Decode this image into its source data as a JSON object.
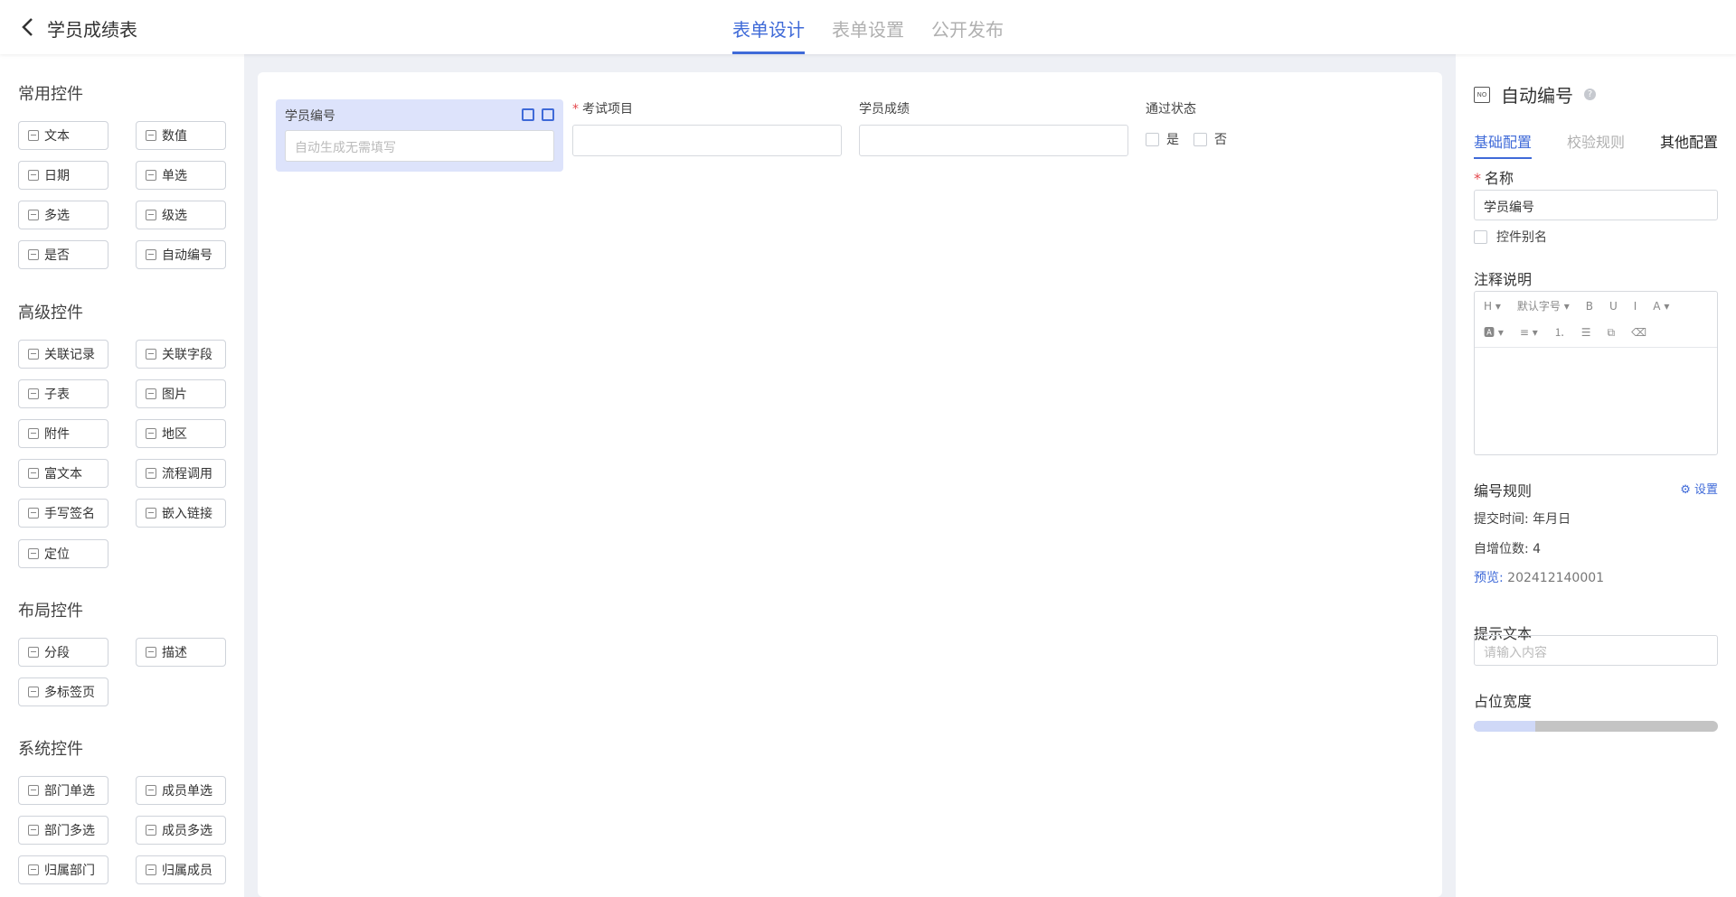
{
  "header": {
    "title": "学员成绩表",
    "tabs": [
      "表单设计",
      "表单设置",
      "公开发布"
    ]
  },
  "palette": {
    "common_title": "常用控件",
    "common": [
      "文本",
      "数值",
      "日期",
      "单选",
      "多选",
      "级选",
      "是否",
      "自动编号"
    ],
    "advanced_title": "高级控件",
    "advanced": [
      "关联记录",
      "关联字段",
      "子表",
      "图片",
      "附件",
      "地区",
      "富文本",
      "流程调用",
      "手写签名",
      "嵌入链接",
      "定位"
    ],
    "layout_title": "布局控件",
    "layout": [
      "分段",
      "描述",
      "多标签页"
    ],
    "system_title": "系统控件",
    "system": [
      "部门单选",
      "成员单选",
      "部门多选",
      "成员多选",
      "归属部门",
      "归属成员"
    ]
  },
  "canvas": {
    "fields": [
      {
        "label": "学员编号",
        "placeholder": "自动生成无需填写"
      },
      {
        "label": "考试项目",
        "required_mark": "*"
      },
      {
        "label": "学员成绩"
      },
      {
        "label": "通过状态",
        "options": [
          "是",
          "否"
        ]
      }
    ]
  },
  "panel": {
    "title": "自动编号",
    "help": "?",
    "tabs": [
      "基础配置",
      "校验规则",
      "其他配置"
    ],
    "name_label": "名称",
    "name_required": "*",
    "name_value": "学员编号",
    "alias_label": "控件别名",
    "note_label": "注释说明",
    "toolbar": [
      "H ▾",
      "默认字号 ▾",
      "B",
      "U",
      "I",
      "A ▾",
      "🅰 ▾",
      "≡ ▾",
      "⒈",
      "☰",
      "⧉",
      "⌫"
    ],
    "rule_label": "编号规则",
    "rule_settings": "设置",
    "submit_time_label": "提交时间:",
    "submit_time_value": "年月日",
    "digits_label": "自增位数:",
    "digits_value": "4",
    "preview_label": "预览:",
    "preview_value": "202412140001",
    "hint_label": "提示文本",
    "hint_placeholder": "请输入内容",
    "width_label": "占位宽度",
    "width_fraction": 0.25
  },
  "colors": {
    "accent": "#3f6ad8",
    "selected_bg": "#dde3fb"
  }
}
